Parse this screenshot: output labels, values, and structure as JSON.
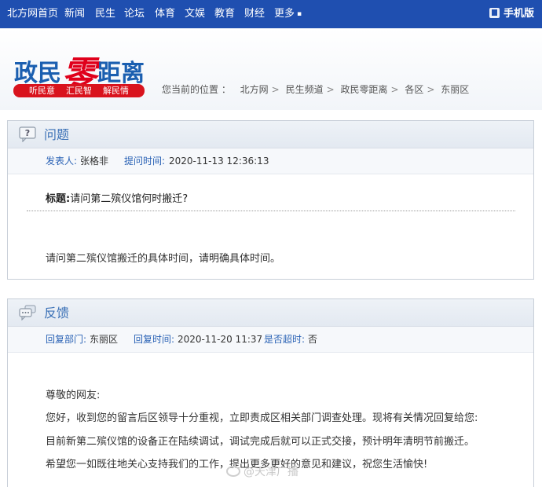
{
  "nav": {
    "items": [
      "北方网首页",
      "新闻",
      "民生",
      "论坛",
      "体育",
      "文娱",
      "教育",
      "财经",
      "更多"
    ],
    "more_glyph": "▪",
    "mobile": "手机版"
  },
  "logo": {
    "part1": "政民",
    "part2": "零",
    "part3": "距离"
  },
  "slogan": [
    "听民意",
    "汇民智",
    "解民情"
  ],
  "breadcrumb": {
    "lead": "您当前的位置 ：",
    "items": [
      "北方网",
      "民生频道",
      "政民零距离",
      "各区",
      "东丽区"
    ],
    "sep": ">"
  },
  "question": {
    "heading": "问题",
    "poster_label": "发表人:",
    "poster": "张格非",
    "time_label": "提问时间:",
    "time": "2020-11-13 12:36:13",
    "title_label": "标题:",
    "title": "请问第二殡仪馆何时搬迁?",
    "body": "请问第二殡仪馆搬迁的具体时间，请明确具体时间。"
  },
  "reply": {
    "heading": "反馈",
    "dept_label": "回复部门:",
    "dept": "东丽区",
    "time_label": "回复时间:",
    "time": "2020-11-20 11:37",
    "overdue_label": "是否超时:",
    "overdue": "否",
    "lines": [
      "尊敬的网友:",
      "您好，收到您的留言后区领导十分重视，立即责成区相关部门调查处理。现将有关情况回复给您:",
      "目前新第二殡仪馆的设备正在陆续调试，调试完成后就可以正式交接，预计明年清明节前搬迁。",
      "希望您一如既往地关心支持我们的工作，提出更多更好的意见和建议，祝您生活愉快!"
    ]
  },
  "watermark": "@天津广播"
}
